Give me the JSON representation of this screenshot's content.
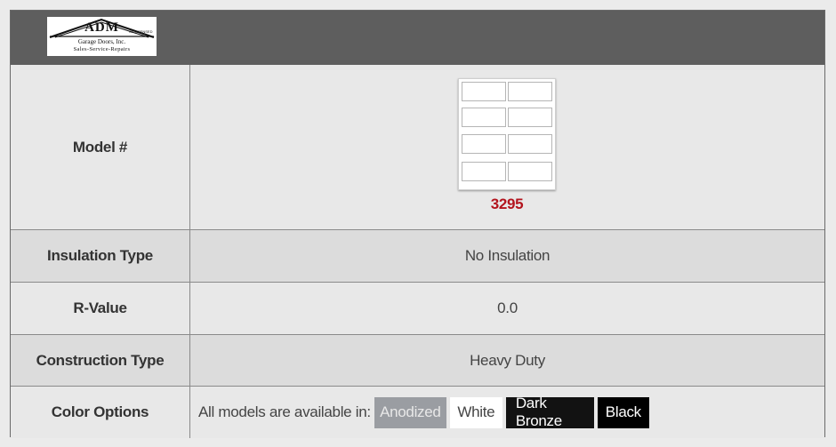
{
  "logo": {
    "title": "ADM",
    "license": "CA LICENSED",
    "company": "Garage Doors, Inc.",
    "tagline": "Sales-Service-Repairs"
  },
  "rows": [
    {
      "label": "Model #",
      "model_number": "3295"
    },
    {
      "label": "Insulation Type",
      "value": "No Insulation"
    },
    {
      "label": "R-Value",
      "value": "0.0"
    },
    {
      "label": "Construction Type",
      "value": "Heavy Duty"
    },
    {
      "label": "Color Options",
      "intro": "All models are available in:"
    }
  ],
  "colors": [
    {
      "name": "Anodized",
      "bg": "#9a9da2",
      "fg": "#e8e8e8"
    },
    {
      "name": "White",
      "bg": "#ffffff",
      "fg": "#444444"
    },
    {
      "name": "Dark Bronze",
      "bg": "#121212",
      "fg": "#ffffff"
    },
    {
      "name": "Black",
      "bg": "#000000",
      "fg": "#ffffff"
    }
  ],
  "theme": {
    "header_bg": "#5e5e5e",
    "model_number_color": "#b3141e"
  }
}
